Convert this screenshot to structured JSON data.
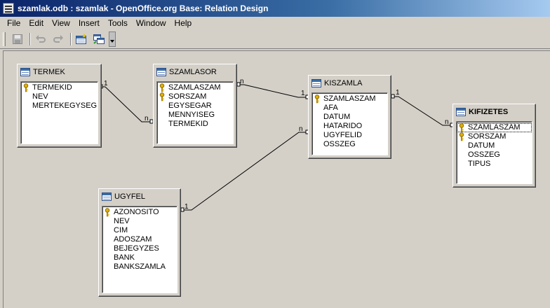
{
  "window": {
    "title": "szamlak.odb : szamlak - OpenOffice.org Base: Relation Design"
  },
  "menu": [
    "File",
    "Edit",
    "View",
    "Insert",
    "Tools",
    "Window",
    "Help"
  ],
  "toolbar": {
    "buttons": [
      "save-icon",
      "undo-icon",
      "redo-icon",
      "new-relation-icon",
      "add-tables-icon"
    ]
  },
  "tables": {
    "termek": {
      "name": "TERMEK",
      "fields": [
        {
          "name": "TERMEKID",
          "key": true
        },
        {
          "name": "NEV",
          "key": false
        },
        {
          "name": "MERTEKEGYSEG",
          "key": false
        }
      ]
    },
    "szamlasor": {
      "name": "SZAMLASOR",
      "fields": [
        {
          "name": "SZAMLASZAM",
          "key": true
        },
        {
          "name": "SORSZAM",
          "key": true
        },
        {
          "name": "EGYSEGAR",
          "key": false
        },
        {
          "name": "MENNYISEG",
          "key": false
        },
        {
          "name": "TERMEKID",
          "key": false
        }
      ]
    },
    "kiszamla": {
      "name": "KISZAMLA",
      "fields": [
        {
          "name": "SZAMLASZAM",
          "key": true
        },
        {
          "name": "AFA",
          "key": false
        },
        {
          "name": "DATUM",
          "key": false
        },
        {
          "name": "HATARIDO",
          "key": false
        },
        {
          "name": "UGYFELID",
          "key": false
        },
        {
          "name": "OSSZEG",
          "key": false
        }
      ]
    },
    "kifizetes": {
      "name": "KIFIZETES",
      "fields": [
        {
          "name": "SZAMLASZAM",
          "key": true
        },
        {
          "name": "SORSZAM",
          "key": true
        },
        {
          "name": "DATUM",
          "key": false
        },
        {
          "name": "OSSZEG",
          "key": false
        },
        {
          "name": "TIPUS",
          "key": false
        }
      ]
    },
    "ugyfel": {
      "name": "UGYFEL",
      "fields": [
        {
          "name": "AZONOSITO",
          "key": true
        },
        {
          "name": "NEV",
          "key": false
        },
        {
          "name": "CIM",
          "key": false
        },
        {
          "name": "ADOSZAM",
          "key": false
        },
        {
          "name": "BEJEGYZES",
          "key": false
        },
        {
          "name": "BANK",
          "key": false
        },
        {
          "name": "BANKSZAMLA",
          "key": false
        }
      ]
    }
  },
  "relations": [
    {
      "from_card": "1",
      "to_card": "n"
    },
    {
      "from_card": "n",
      "to_card": "1"
    },
    {
      "from_card": "1",
      "to_card": "n"
    },
    {
      "from_card": "1",
      "to_card": "n"
    }
  ],
  "colors": {
    "titlebar_start": "#0a246a",
    "titlebar_end": "#a6caf0",
    "background": "#d4d0c8",
    "key": "#d4a017"
  }
}
